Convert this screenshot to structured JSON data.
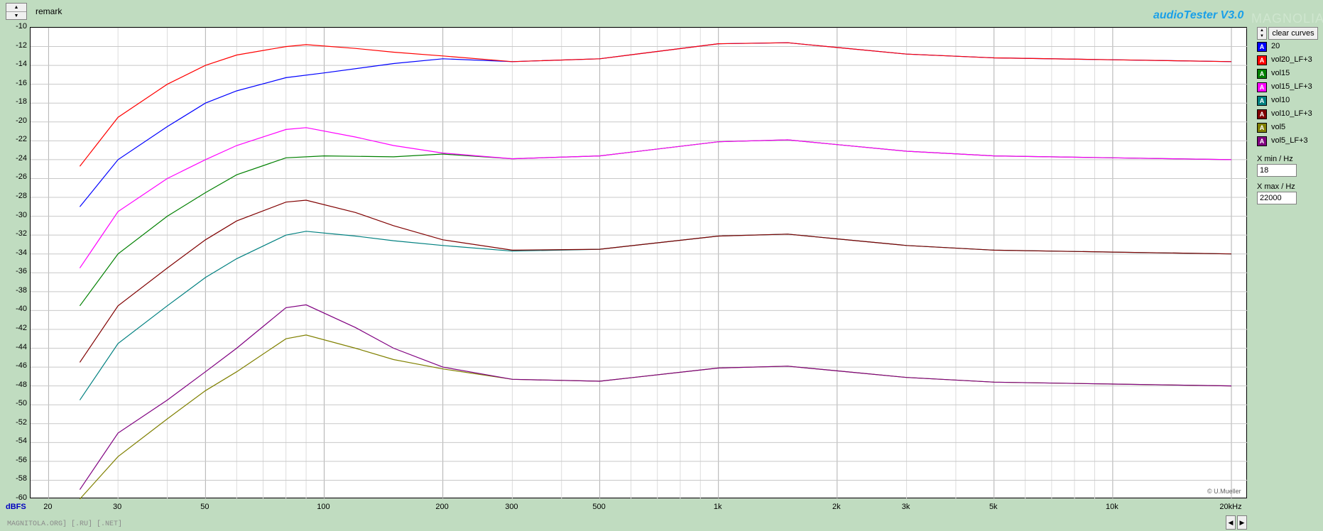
{
  "header": {
    "remark_label": "remark",
    "app_title": "audioTester  V3.0",
    "watermark": "MAGNOLIA"
  },
  "footer": {
    "bottom_url": "MAGNITOLA.ORG] [.RU] [.NET]",
    "copyright": "© U.Mueller"
  },
  "sidebar": {
    "clear_label": "clear curves",
    "legend": [
      {
        "label": "20",
        "color": "#0000ff"
      },
      {
        "label": "vol20_LF+3",
        "color": "#ff0000"
      },
      {
        "label": "vol15",
        "color": "#008000"
      },
      {
        "label": "vol15_LF+3",
        "color": "#ff00ff"
      },
      {
        "label": "vol10",
        "color": "#008080"
      },
      {
        "label": "vol10_LF+3",
        "color": "#800000"
      },
      {
        "label": "vol5",
        "color": "#808000"
      },
      {
        "label": "vol5_LF+3",
        "color": "#800080"
      }
    ],
    "xmin_label": "X min / Hz",
    "xmin_value": "18",
    "xmax_label": "X max / Hz",
    "xmax_value": "22000"
  },
  "chart_data": {
    "type": "line",
    "xscale": "log",
    "xlim": [
      18,
      22000
    ],
    "ylim": [
      -60,
      -10
    ],
    "grid": true,
    "yunit": "dBFS",
    "yticks": [
      "-10",
      "-12",
      "-14",
      "-16",
      "-18",
      "-20",
      "-22",
      "-24",
      "-26",
      "-28",
      "-30",
      "-32",
      "-34",
      "-36",
      "-38",
      "-40",
      "-42",
      "-44",
      "-46",
      "-48",
      "-50",
      "-52",
      "-54",
      "-56",
      "-58",
      "-60"
    ],
    "xticks": [
      {
        "value": 20,
        "label": "20"
      },
      {
        "value": 30,
        "label": "30"
      },
      {
        "value": 50,
        "label": "50"
      },
      {
        "value": 100,
        "label": "100"
      },
      {
        "value": 200,
        "label": "200"
      },
      {
        "value": 300,
        "label": "300"
      },
      {
        "value": 500,
        "label": "500"
      },
      {
        "value": 1000,
        "label": "1k"
      },
      {
        "value": 2000,
        "label": "2k"
      },
      {
        "value": 3000,
        "label": "3k"
      },
      {
        "value": 5000,
        "label": "5k"
      },
      {
        "value": 10000,
        "label": "10k"
      },
      {
        "value": 20000,
        "label": "20kHz"
      }
    ],
    "series": [
      {
        "name": "20",
        "color": "#0000ff",
        "x": [
          24,
          30,
          40,
          50,
          60,
          80,
          100,
          150,
          200,
          300,
          500,
          1000,
          1500,
          2000,
          3000,
          5000,
          10000,
          20000
        ],
        "y": [
          -29,
          -24,
          -20.5,
          -18,
          -16.7,
          -15.3,
          -14.8,
          -13.8,
          -13.3,
          -13.6,
          -13.3,
          -11.7,
          -11.6,
          -12.1,
          -12.8,
          -13.2,
          -13.4,
          -13.6
        ]
      },
      {
        "name": "vol20_LF+3",
        "color": "#ff0000",
        "x": [
          24,
          30,
          40,
          50,
          60,
          80,
          90,
          120,
          150,
          200,
          300,
          500,
          1000,
          1500,
          2000,
          3000,
          5000,
          10000,
          20000
        ],
        "y": [
          -24.7,
          -19.5,
          -16,
          -14,
          -12.9,
          -12.0,
          -11.8,
          -12.2,
          -12.6,
          -13.0,
          -13.6,
          -13.3,
          -11.7,
          -11.6,
          -12.1,
          -12.8,
          -13.2,
          -13.4,
          -13.6
        ]
      },
      {
        "name": "vol15",
        "color": "#008000",
        "x": [
          24,
          30,
          40,
          50,
          60,
          80,
          100,
          150,
          200,
          300,
          500,
          1000,
          1500,
          2000,
          3000,
          5000,
          10000,
          20000
        ],
        "y": [
          -39.5,
          -34,
          -30,
          -27.5,
          -25.6,
          -23.8,
          -23.6,
          -23.7,
          -23.4,
          -23.9,
          -23.6,
          -22.1,
          -21.9,
          -22.4,
          -23.1,
          -23.6,
          -23.8,
          -24.0
        ]
      },
      {
        "name": "vol15_LF+3",
        "color": "#ff00ff",
        "x": [
          24,
          30,
          40,
          50,
          60,
          80,
          90,
          120,
          150,
          200,
          300,
          500,
          1000,
          1500,
          2000,
          3000,
          5000,
          10000,
          20000
        ],
        "y": [
          -35.5,
          -29.5,
          -26,
          -24,
          -22.5,
          -20.8,
          -20.6,
          -21.6,
          -22.5,
          -23.3,
          -23.9,
          -23.6,
          -22.1,
          -21.9,
          -22.4,
          -23.1,
          -23.6,
          -23.8,
          -24.0
        ]
      },
      {
        "name": "vol10",
        "color": "#008080",
        "x": [
          24,
          30,
          40,
          50,
          60,
          80,
          90,
          120,
          150,
          200,
          300,
          500,
          1000,
          1500,
          2000,
          3000,
          5000,
          10000,
          20000
        ],
        "y": [
          -49.5,
          -43.5,
          -39.5,
          -36.5,
          -34.5,
          -32,
          -31.6,
          -32.1,
          -32.6,
          -33.1,
          -33.7,
          -33.5,
          -32.1,
          -31.9,
          -32.4,
          -33.1,
          -33.6,
          -33.8,
          -34.0
        ]
      },
      {
        "name": "vol10_LF+3",
        "color": "#800000",
        "x": [
          24,
          30,
          40,
          50,
          60,
          80,
          90,
          120,
          150,
          200,
          300,
          500,
          1000,
          1500,
          2000,
          3000,
          5000,
          10000,
          20000
        ],
        "y": [
          -45.5,
          -39.5,
          -35.5,
          -32.5,
          -30.5,
          -28.5,
          -28.3,
          -29.6,
          -31,
          -32.5,
          -33.6,
          -33.5,
          -32.1,
          -31.9,
          -32.4,
          -33.1,
          -33.6,
          -33.8,
          -34.0
        ]
      },
      {
        "name": "vol5",
        "color": "#808000",
        "x": [
          24,
          30,
          40,
          50,
          60,
          80,
          90,
          120,
          150,
          200,
          300,
          500,
          1000,
          1500,
          2000,
          3000,
          5000,
          10000,
          20000
        ],
        "y": [
          -60,
          -55.5,
          -51.5,
          -48.5,
          -46.5,
          -43,
          -42.6,
          -44,
          -45.2,
          -46.2,
          -47.3,
          -47.5,
          -46.1,
          -45.9,
          -46.4,
          -47.1,
          -47.6,
          -47.8,
          -48.0
        ]
      },
      {
        "name": "vol5_LF+3",
        "color": "#800080",
        "x": [
          24,
          30,
          40,
          50,
          60,
          80,
          90,
          120,
          150,
          200,
          300,
          500,
          1000,
          1500,
          2000,
          3000,
          5000,
          10000,
          20000
        ],
        "y": [
          -59,
          -53,
          -49.5,
          -46.5,
          -44,
          -39.7,
          -39.4,
          -41.8,
          -44,
          -46,
          -47.3,
          -47.5,
          -46.1,
          -45.9,
          -46.4,
          -47.1,
          -47.6,
          -47.8,
          -48.0
        ]
      }
    ]
  }
}
